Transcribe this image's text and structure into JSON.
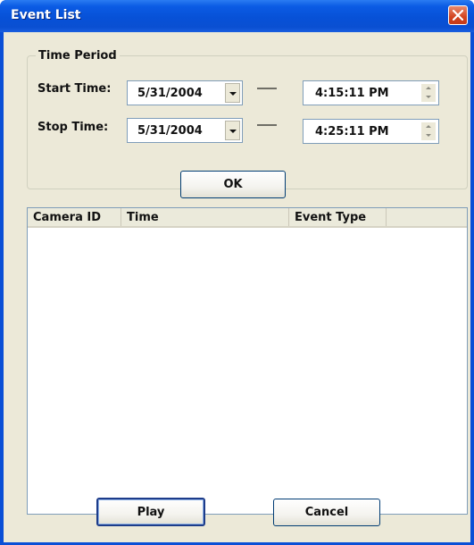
{
  "window": {
    "title": "Event List"
  },
  "time_period": {
    "group_label": "Time Period",
    "start_label": "Start Time:",
    "stop_label": "Stop Time:",
    "start_date": "5/31/2004",
    "stop_date": "5/31/2004",
    "start_time": "4:15:11 PM",
    "stop_time": "4:25:11 PM"
  },
  "ok_button": "OK",
  "event_table": {
    "columns": [
      "Camera ID",
      "Time",
      "Event Type",
      ""
    ],
    "rows": []
  },
  "buttons": {
    "play": "Play",
    "cancel": "Cancel"
  },
  "colors": {
    "titlebar": "#0A4FD6",
    "client_bg": "#ECE9D8",
    "close_button": "#D2441F"
  },
  "icons": {
    "close": "close-icon",
    "dropdown": "chevron-down-icon",
    "spin_up": "spin-up-icon",
    "spin_down": "spin-down-icon"
  }
}
